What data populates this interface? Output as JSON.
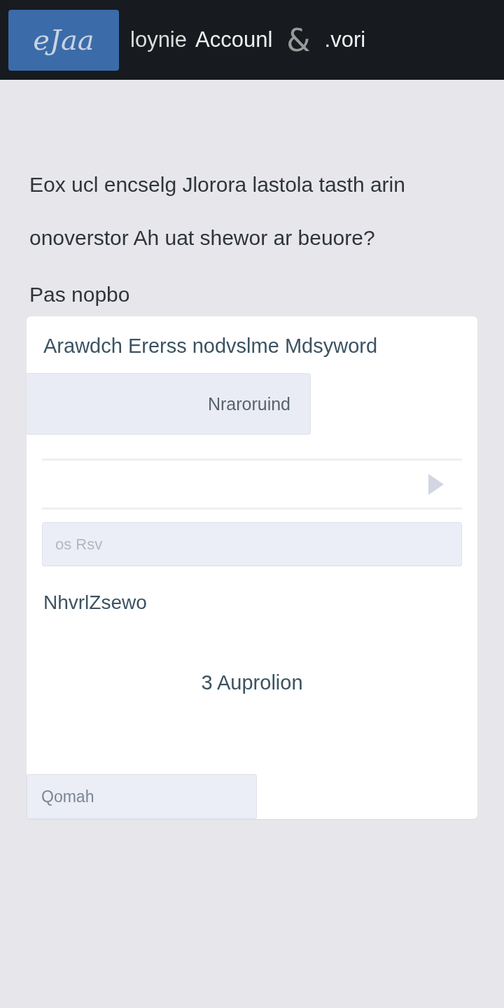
{
  "header": {
    "logo": "eJaa",
    "title_parts": [
      {
        "text": "loynie",
        "kind": "light"
      },
      {
        "text": "Accounl",
        "kind": "strong"
      },
      {
        "text": "&",
        "kind": "symbol"
      },
      {
        "text": ".vori",
        "kind": "strong"
      }
    ]
  },
  "prompt": "Eox ucl encselg Jlorora lastola tasth arin\nonoverstor Ah uat shewor ar beuore?",
  "section_label": "Pas nopbo",
  "card": {
    "heading": "Arawdch Ererss nodvslme Mdsyword",
    "option_button": "Nraroruind",
    "field": {
      "placeholder": "os Rsv"
    },
    "field_label": "NhvrlZsewo",
    "action_button": "3 Auprolion",
    "bottom_field": {
      "placeholder": "Qomah"
    }
  }
}
